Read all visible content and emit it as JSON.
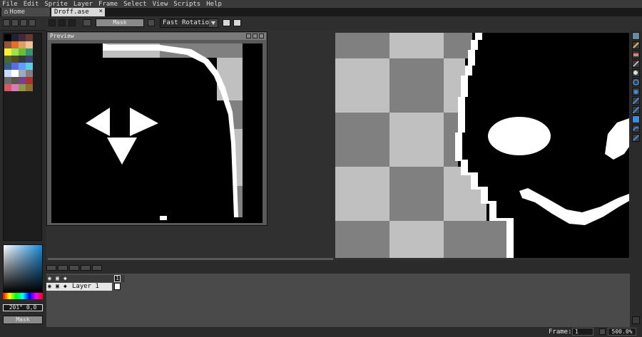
{
  "menu": [
    "File",
    "Edit",
    "Sprite",
    "Layer",
    "Frame",
    "Select",
    "View",
    "Scripts",
    "Help"
  ],
  "tabs": {
    "home_label": "Home",
    "file_label": "Droff.ase",
    "close_glyph": "×"
  },
  "toolbar": {
    "mask_label": "Mask",
    "rotation_algorithm": "Fast Rotation"
  },
  "preview": {
    "title": "Preview"
  },
  "palette": {
    "colors": [
      "#000000",
      "#222034",
      "#45283c",
      "#663931",
      "#8f563b",
      "#df7126",
      "#d9a066",
      "#eec39a",
      "#fbf236",
      "#99e550",
      "#6abe30",
      "#37946e",
      "#4b692f",
      "#524b24",
      "#323c39",
      "#3f3f74",
      "#306082",
      "#5b6ee1",
      "#639bff",
      "#5fcde4",
      "#cbdbfc",
      "#ffffff",
      "#9badb7",
      "#847e87",
      "#696a6a",
      "#595652",
      "#76428a",
      "#ac3232",
      "#d95763",
      "#d77bba",
      "#8f974a",
      "#8a6f30"
    ]
  },
  "color_picker": {
    "hsv_label": "201° 0,0",
    "mask_label": "Mask"
  },
  "timeline": {
    "frame_number": "1",
    "layer_name": "Layer 1"
  },
  "status": {
    "frame_label": "Frame:",
    "frame_value": "1",
    "zoom": "500.0%"
  },
  "colors": {
    "accent_blue": "#3c8de0",
    "dark_bg": "#2b2b2b",
    "panel_gray": "#4a4a4a"
  }
}
